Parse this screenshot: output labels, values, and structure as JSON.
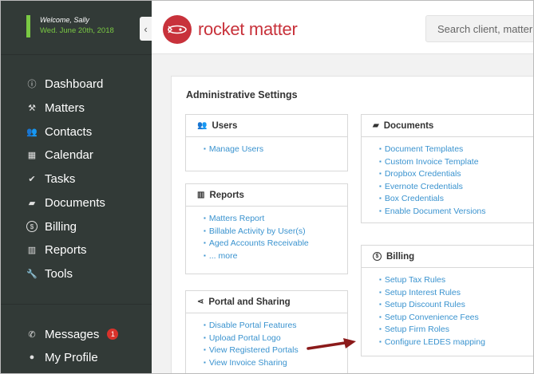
{
  "welcome": {
    "greeting": "Welcome, Sally",
    "date": "Wed. June 20th, 2018"
  },
  "sidebar": {
    "collapse_glyph": "‹",
    "items": [
      {
        "label": "Dashboard",
        "icon": "info-icon",
        "glyph": "ⓘ"
      },
      {
        "label": "Matters",
        "icon": "gavel-icon",
        "glyph": "⚒"
      },
      {
        "label": "Contacts",
        "icon": "contacts-icon",
        "glyph": "👥"
      },
      {
        "label": "Calendar",
        "icon": "calendar-icon",
        "glyph": "▦"
      },
      {
        "label": "Tasks",
        "icon": "check-icon",
        "glyph": "✔"
      },
      {
        "label": "Documents",
        "icon": "folder-icon",
        "glyph": "▰"
      },
      {
        "label": "Billing",
        "icon": "dollar-icon",
        "glyph": "$"
      },
      {
        "label": "Reports",
        "icon": "bar-chart-icon",
        "glyph": "▥"
      },
      {
        "label": "Tools",
        "icon": "wrench-icon",
        "glyph": "🔧"
      }
    ],
    "bottom_items": [
      {
        "label": "Messages",
        "icon": "phone-icon",
        "glyph": "✆",
        "badge": "1"
      },
      {
        "label": "My Profile",
        "icon": "user-icon",
        "glyph": "●"
      }
    ]
  },
  "header": {
    "brand": "rocket matter",
    "search_placeholder": "Search client, matter"
  },
  "main": {
    "title": "Administrative Settings",
    "panels": {
      "users": {
        "title": "Users",
        "icon": "users-icon",
        "glyph": "👥",
        "links": [
          "Manage Users"
        ]
      },
      "reports": {
        "title": "Reports",
        "icon": "bar-chart-icon",
        "glyph": "▥",
        "links": [
          "Matters Report",
          "Billable Activity by User(s)",
          "Aged Accounts Receivable",
          "... more"
        ]
      },
      "portal": {
        "title": "Portal and Sharing",
        "icon": "share-icon",
        "glyph": "⋖",
        "links": [
          "Disable Portal Features",
          "Upload Portal Logo",
          "View Registered Portals",
          "View Invoice Sharing"
        ]
      },
      "documents": {
        "title": "Documents",
        "icon": "folder-icon",
        "glyph": "▰",
        "links": [
          "Document Templates",
          "Custom Invoice Template",
          "Dropbox Credentials",
          "Evernote Credentials",
          "Box Credentials",
          "Enable Document Versions"
        ]
      },
      "billing": {
        "title": "Billing",
        "icon": "dollar-icon",
        "glyph": "$",
        "links": [
          "Setup Tax Rules",
          "Setup Interest Rules",
          "Setup Discount Rules",
          "Setup Convenience Fees",
          "Setup Firm Roles",
          "Configure LEDES mapping"
        ]
      }
    }
  },
  "colors": {
    "accent": "#3a93cf",
    "brand": "#c8323b",
    "sidebar": "#323a37",
    "welcome": "#7ac943",
    "arrow": "#8b1a1a"
  }
}
